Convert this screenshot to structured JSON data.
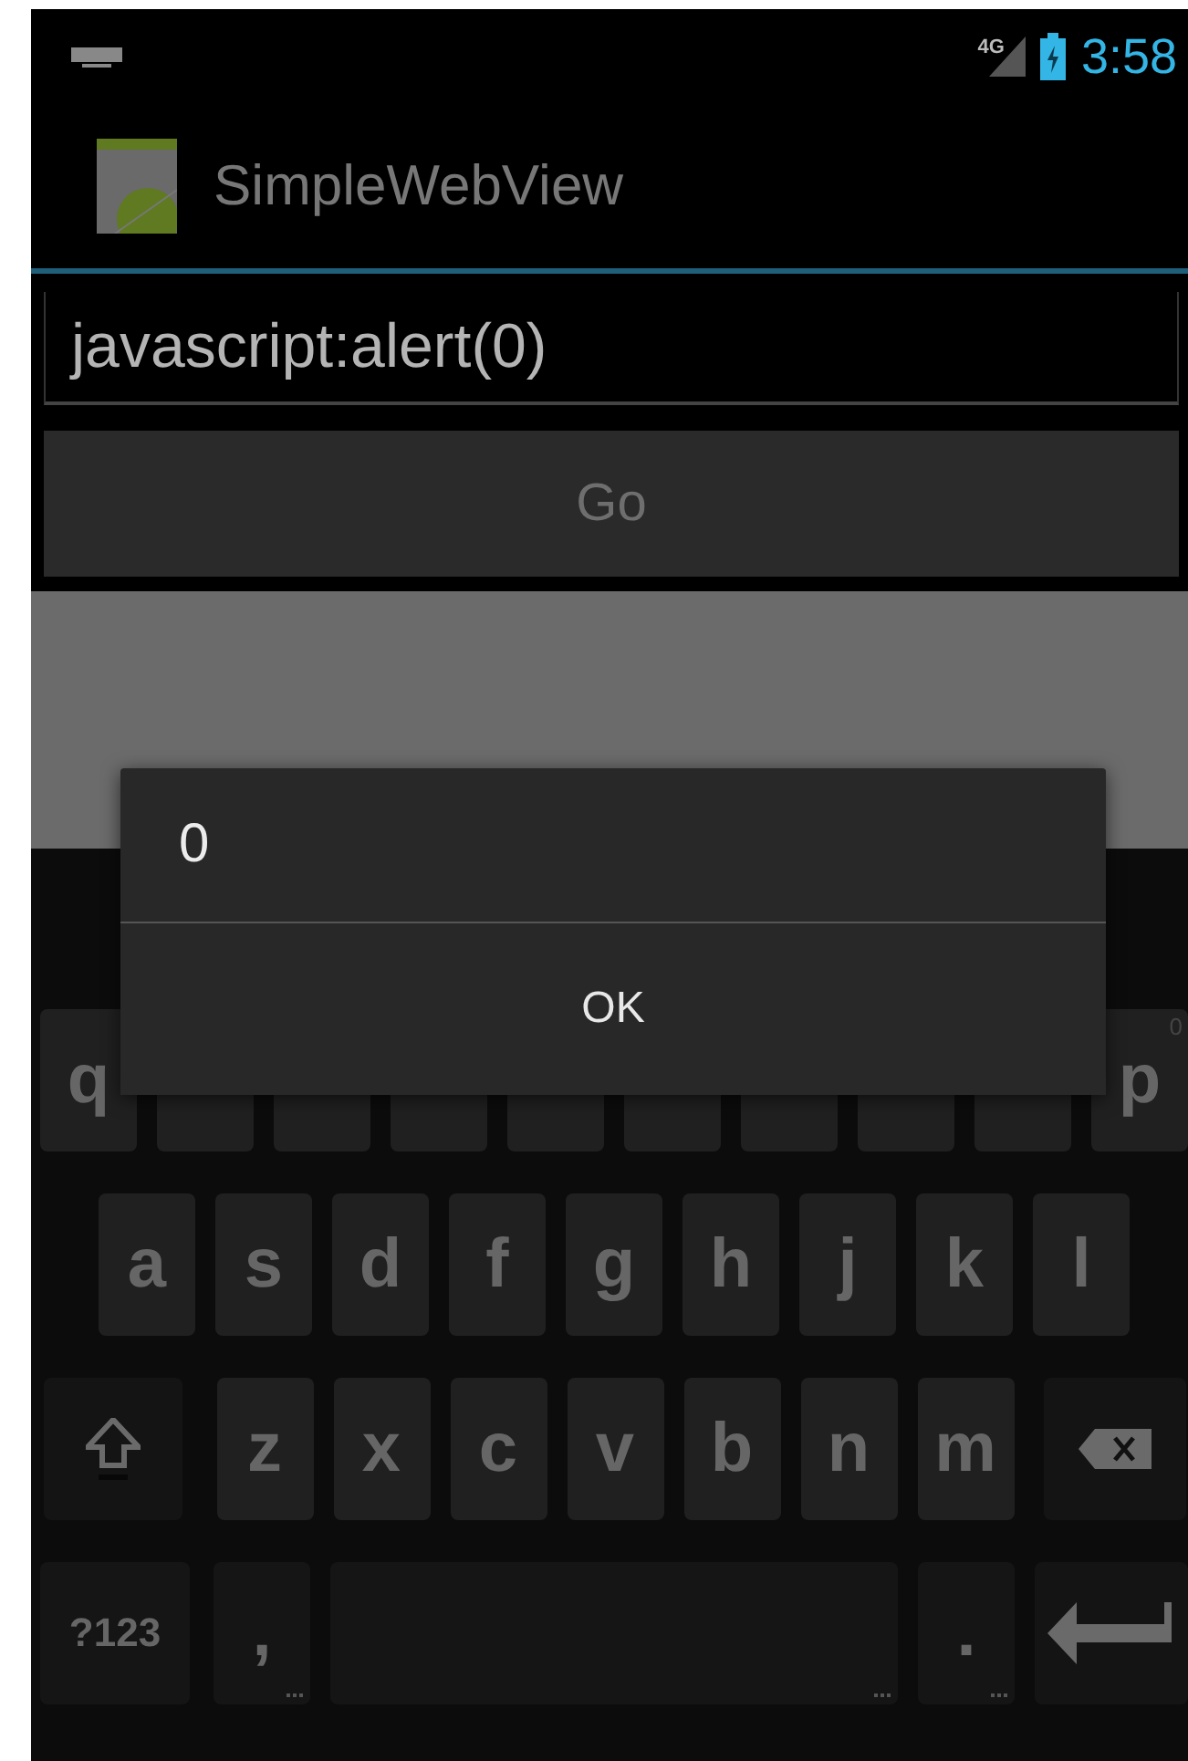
{
  "status_bar": {
    "network": "4G",
    "time": "3:58"
  },
  "app_bar": {
    "title": "SimpleWebView"
  },
  "url_field": {
    "value": "javascript:alert(0)"
  },
  "go_button": {
    "label": "Go"
  },
  "keyboard": {
    "rows": [
      {
        "keys": [
          {
            "kind": "char",
            "label": "q"
          },
          {
            "kind": "char"
          },
          {
            "kind": "char"
          },
          {
            "kind": "char"
          },
          {
            "kind": "char"
          },
          {
            "kind": "char"
          },
          {
            "kind": "char"
          },
          {
            "kind": "char"
          },
          {
            "kind": "char"
          },
          {
            "kind": "char",
            "label": "p",
            "hint": "0"
          }
        ]
      },
      {
        "keys": [
          {
            "kind": "char",
            "label": "a"
          },
          {
            "kind": "char",
            "label": "s"
          },
          {
            "kind": "char",
            "label": "d"
          },
          {
            "kind": "char",
            "label": "f"
          },
          {
            "kind": "char",
            "label": "g"
          },
          {
            "kind": "char",
            "label": "h"
          },
          {
            "kind": "char",
            "label": "j"
          },
          {
            "kind": "char",
            "label": "k"
          },
          {
            "kind": "char",
            "label": "l"
          }
        ]
      },
      {
        "keys": [
          {
            "kind": "shift"
          },
          {
            "kind": "char",
            "label": "z"
          },
          {
            "kind": "char",
            "label": "x"
          },
          {
            "kind": "char",
            "label": "c"
          },
          {
            "kind": "char",
            "label": "v"
          },
          {
            "kind": "char",
            "label": "b"
          },
          {
            "kind": "char",
            "label": "n"
          },
          {
            "kind": "char",
            "label": "m"
          },
          {
            "kind": "delete"
          }
        ]
      },
      {
        "keys": [
          {
            "kind": "symbols",
            "label": "?123"
          },
          {
            "kind": "punct",
            "label": ",",
            "popup": true
          },
          {
            "kind": "space",
            "popup": true
          },
          {
            "kind": "punct",
            "label": ".",
            "popup": true
          },
          {
            "kind": "enter"
          }
        ]
      }
    ]
  },
  "dialog": {
    "message": "0",
    "buttons": [
      "OK"
    ]
  }
}
